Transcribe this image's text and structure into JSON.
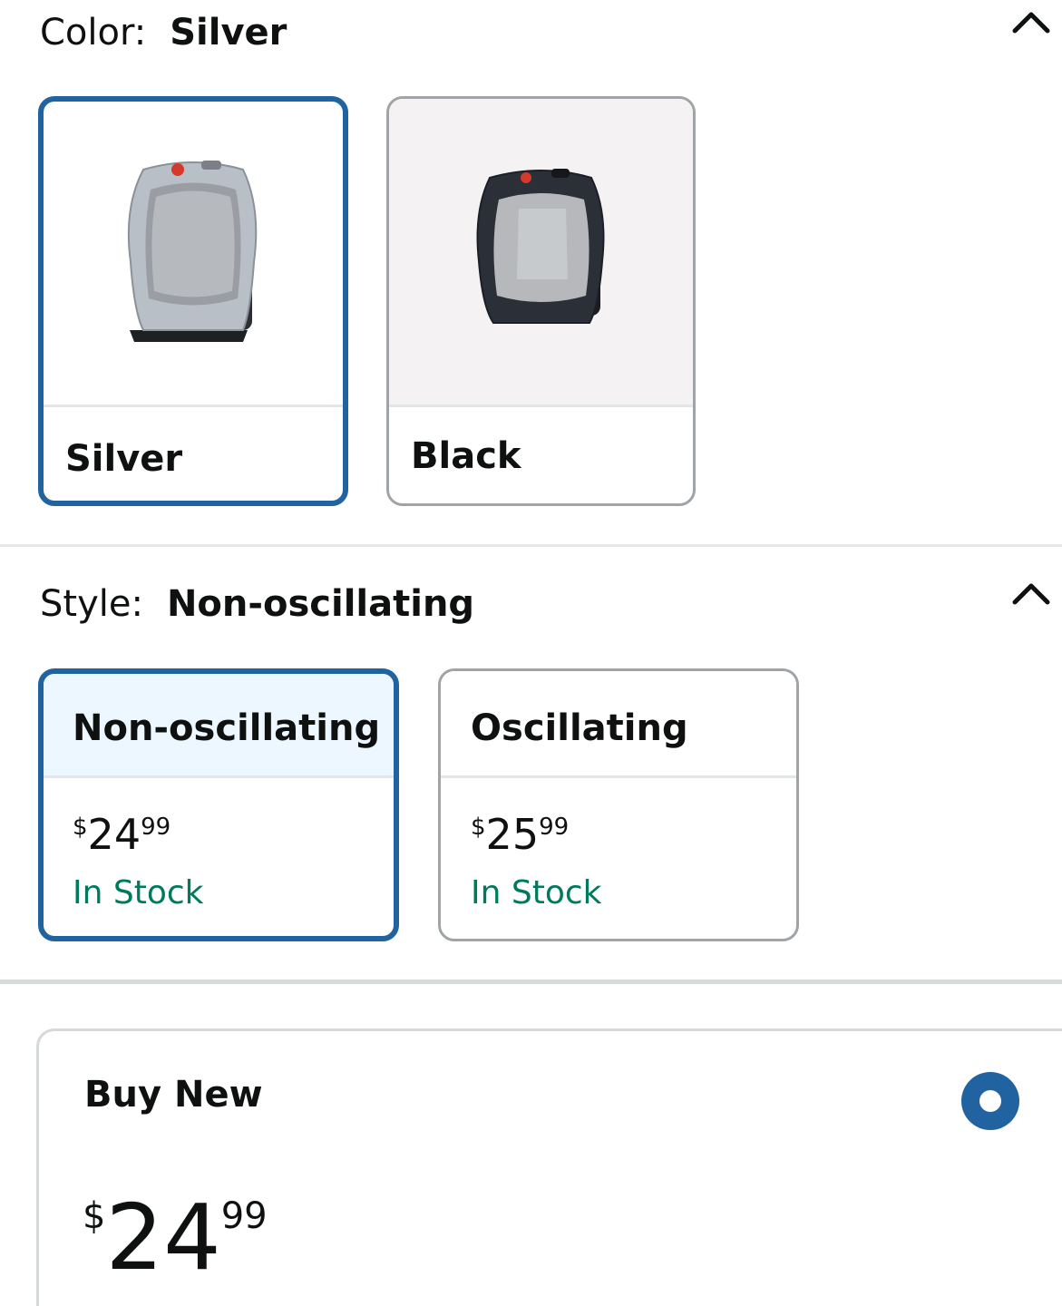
{
  "color_section": {
    "key_label": "Color:",
    "selected_value": "Silver",
    "options": [
      {
        "label": "Silver",
        "selected": true,
        "product_color": "#b9bfc6",
        "icon": "silver-heater-image"
      },
      {
        "label": "Black",
        "selected": false,
        "product_color": "#2b2f38",
        "icon": "black-heater-image"
      }
    ]
  },
  "style_section": {
    "key_label": "Style:",
    "selected_value": "Non-oscillating",
    "options": [
      {
        "label": "Non-oscillating",
        "selected": true,
        "price_symbol": "$",
        "price_whole": "24",
        "price_fraction": "99",
        "availability": "In Stock"
      },
      {
        "label": "Oscillating",
        "selected": false,
        "price_symbol": "$",
        "price_whole": "25",
        "price_fraction": "99",
        "availability": "In Stock"
      }
    ]
  },
  "buy_box": {
    "title": "Buy New",
    "selected": true,
    "price_symbol": "$",
    "price_whole": "24",
    "price_fraction": "99"
  },
  "colors": {
    "selected_border": "#2162a1",
    "in_stock": "#007a5c",
    "selected_header_bg": "#edf7ff"
  }
}
